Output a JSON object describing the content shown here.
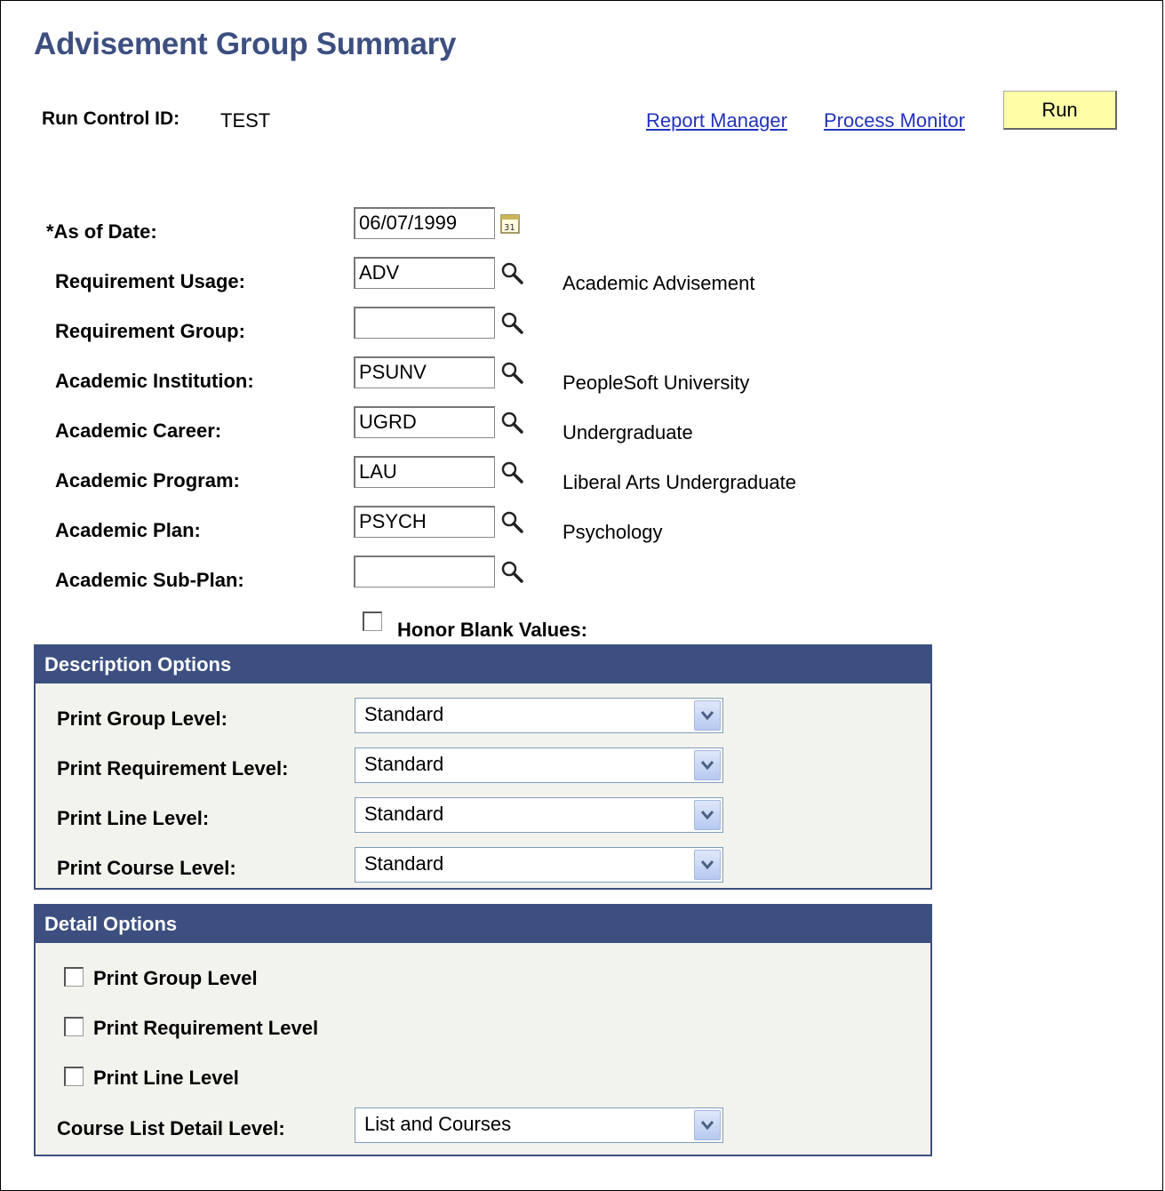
{
  "page": {
    "title": "Advisement Group Summary"
  },
  "run_control": {
    "label": "Run Control ID:",
    "value": "TEST"
  },
  "toolbar": {
    "report_manager": "Report Manager",
    "process_monitor": "Process Monitor",
    "run_label": "Run"
  },
  "form": {
    "as_of_date": {
      "label": "*As of Date:",
      "value": "06/07/1999"
    },
    "requirement_usage": {
      "label": "Requirement Usage:",
      "value": "ADV",
      "description": "Academic Advisement"
    },
    "requirement_group": {
      "label": "Requirement Group:",
      "value": "",
      "description": ""
    },
    "academic_institution": {
      "label": "Academic Institution:",
      "value": "PSUNV",
      "description": "PeopleSoft University"
    },
    "academic_career": {
      "label": "Academic Career:",
      "value": "UGRD",
      "description": "Undergraduate"
    },
    "academic_program": {
      "label": "Academic Program:",
      "value": "LAU",
      "description": "Liberal Arts Undergraduate"
    },
    "academic_plan": {
      "label": "Academic Plan:",
      "value": "PSYCH",
      "description": "Psychology"
    },
    "academic_sub_plan": {
      "label": "Academic Sub-Plan:",
      "value": "",
      "description": ""
    },
    "honor_blank_values": {
      "label": "Honor Blank Values:",
      "checked": false
    }
  },
  "description_options": {
    "title": "Description Options",
    "print_group_level": {
      "label": "Print Group Level:",
      "value": "Standard"
    },
    "print_requirement_level": {
      "label": "Print Requirement Level:",
      "value": "Standard"
    },
    "print_line_level": {
      "label": "Print Line Level:",
      "value": "Standard"
    },
    "print_course_level": {
      "label": "Print Course Level:",
      "value": "Standard"
    }
  },
  "detail_options": {
    "title": "Detail Options",
    "print_group_level": {
      "label": "Print Group Level",
      "checked": false
    },
    "print_requirement_level": {
      "label": "Print Requirement Level",
      "checked": false
    },
    "print_line_level": {
      "label": "Print Line Level",
      "checked": false
    },
    "course_list_detail_level": {
      "label": "Course List Detail Level:",
      "value": "List and Courses"
    }
  },
  "colors": {
    "title": "#3d4f80",
    "section_header": "#3d4f80",
    "link": "#2233bb",
    "run_button": "#ffffa8"
  },
  "icons": [
    "calendar-icon",
    "lookup-icon",
    "dropdown-arrow-icon"
  ]
}
